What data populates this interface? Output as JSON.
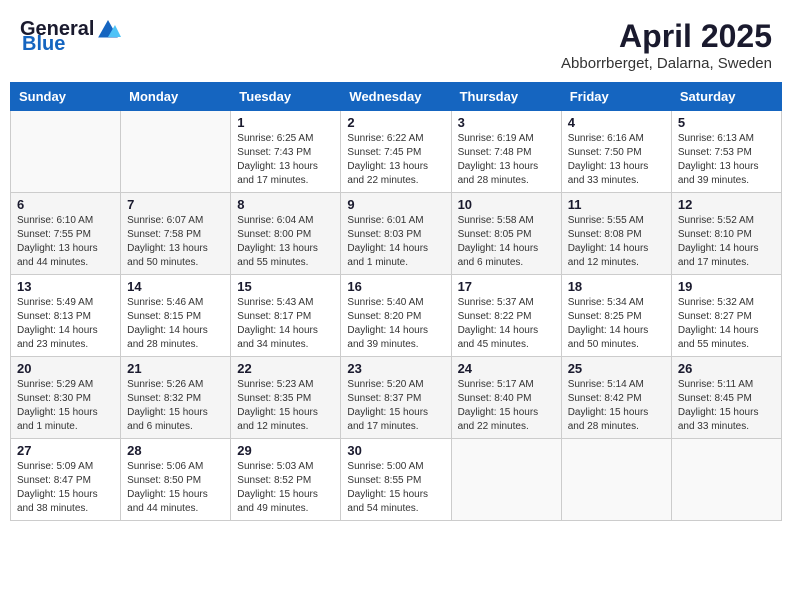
{
  "header": {
    "logo_general": "General",
    "logo_blue": "Blue",
    "month_year": "April 2025",
    "location": "Abborrberget, Dalarna, Sweden"
  },
  "weekdays": [
    "Sunday",
    "Monday",
    "Tuesday",
    "Wednesday",
    "Thursday",
    "Friday",
    "Saturday"
  ],
  "weeks": [
    [
      {
        "day": null,
        "info": null
      },
      {
        "day": null,
        "info": null
      },
      {
        "day": "1",
        "info": "Sunrise: 6:25 AM\nSunset: 7:43 PM\nDaylight: 13 hours and 17 minutes."
      },
      {
        "day": "2",
        "info": "Sunrise: 6:22 AM\nSunset: 7:45 PM\nDaylight: 13 hours and 22 minutes."
      },
      {
        "day": "3",
        "info": "Sunrise: 6:19 AM\nSunset: 7:48 PM\nDaylight: 13 hours and 28 minutes."
      },
      {
        "day": "4",
        "info": "Sunrise: 6:16 AM\nSunset: 7:50 PM\nDaylight: 13 hours and 33 minutes."
      },
      {
        "day": "5",
        "info": "Sunrise: 6:13 AM\nSunset: 7:53 PM\nDaylight: 13 hours and 39 minutes."
      }
    ],
    [
      {
        "day": "6",
        "info": "Sunrise: 6:10 AM\nSunset: 7:55 PM\nDaylight: 13 hours and 44 minutes."
      },
      {
        "day": "7",
        "info": "Sunrise: 6:07 AM\nSunset: 7:58 PM\nDaylight: 13 hours and 50 minutes."
      },
      {
        "day": "8",
        "info": "Sunrise: 6:04 AM\nSunset: 8:00 PM\nDaylight: 13 hours and 55 minutes."
      },
      {
        "day": "9",
        "info": "Sunrise: 6:01 AM\nSunset: 8:03 PM\nDaylight: 14 hours and 1 minute."
      },
      {
        "day": "10",
        "info": "Sunrise: 5:58 AM\nSunset: 8:05 PM\nDaylight: 14 hours and 6 minutes."
      },
      {
        "day": "11",
        "info": "Sunrise: 5:55 AM\nSunset: 8:08 PM\nDaylight: 14 hours and 12 minutes."
      },
      {
        "day": "12",
        "info": "Sunrise: 5:52 AM\nSunset: 8:10 PM\nDaylight: 14 hours and 17 minutes."
      }
    ],
    [
      {
        "day": "13",
        "info": "Sunrise: 5:49 AM\nSunset: 8:13 PM\nDaylight: 14 hours and 23 minutes."
      },
      {
        "day": "14",
        "info": "Sunrise: 5:46 AM\nSunset: 8:15 PM\nDaylight: 14 hours and 28 minutes."
      },
      {
        "day": "15",
        "info": "Sunrise: 5:43 AM\nSunset: 8:17 PM\nDaylight: 14 hours and 34 minutes."
      },
      {
        "day": "16",
        "info": "Sunrise: 5:40 AM\nSunset: 8:20 PM\nDaylight: 14 hours and 39 minutes."
      },
      {
        "day": "17",
        "info": "Sunrise: 5:37 AM\nSunset: 8:22 PM\nDaylight: 14 hours and 45 minutes."
      },
      {
        "day": "18",
        "info": "Sunrise: 5:34 AM\nSunset: 8:25 PM\nDaylight: 14 hours and 50 minutes."
      },
      {
        "day": "19",
        "info": "Sunrise: 5:32 AM\nSunset: 8:27 PM\nDaylight: 14 hours and 55 minutes."
      }
    ],
    [
      {
        "day": "20",
        "info": "Sunrise: 5:29 AM\nSunset: 8:30 PM\nDaylight: 15 hours and 1 minute."
      },
      {
        "day": "21",
        "info": "Sunrise: 5:26 AM\nSunset: 8:32 PM\nDaylight: 15 hours and 6 minutes."
      },
      {
        "day": "22",
        "info": "Sunrise: 5:23 AM\nSunset: 8:35 PM\nDaylight: 15 hours and 12 minutes."
      },
      {
        "day": "23",
        "info": "Sunrise: 5:20 AM\nSunset: 8:37 PM\nDaylight: 15 hours and 17 minutes."
      },
      {
        "day": "24",
        "info": "Sunrise: 5:17 AM\nSunset: 8:40 PM\nDaylight: 15 hours and 22 minutes."
      },
      {
        "day": "25",
        "info": "Sunrise: 5:14 AM\nSunset: 8:42 PM\nDaylight: 15 hours and 28 minutes."
      },
      {
        "day": "26",
        "info": "Sunrise: 5:11 AM\nSunset: 8:45 PM\nDaylight: 15 hours and 33 minutes."
      }
    ],
    [
      {
        "day": "27",
        "info": "Sunrise: 5:09 AM\nSunset: 8:47 PM\nDaylight: 15 hours and 38 minutes."
      },
      {
        "day": "28",
        "info": "Sunrise: 5:06 AM\nSunset: 8:50 PM\nDaylight: 15 hours and 44 minutes."
      },
      {
        "day": "29",
        "info": "Sunrise: 5:03 AM\nSunset: 8:52 PM\nDaylight: 15 hours and 49 minutes."
      },
      {
        "day": "30",
        "info": "Sunrise: 5:00 AM\nSunset: 8:55 PM\nDaylight: 15 hours and 54 minutes."
      },
      {
        "day": null,
        "info": null
      },
      {
        "day": null,
        "info": null
      },
      {
        "day": null,
        "info": null
      }
    ]
  ]
}
